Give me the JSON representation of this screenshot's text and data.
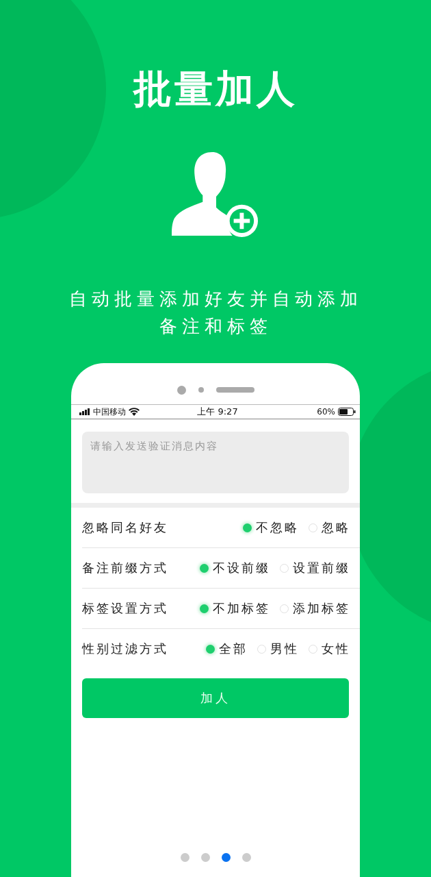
{
  "title": "批量加人",
  "subtitle_lines": [
    "自动批量添加好友并自动添加",
    "备注和标签"
  ],
  "phone": {
    "status_bar": {
      "carrier": "中国移动",
      "time": "上午 9:27",
      "battery": "60%"
    },
    "message_field": {
      "placeholder": "请输入发送验证消息内容"
    },
    "settings": [
      {
        "label": "忽略同名好友",
        "options": [
          {
            "label": "不忽略",
            "selected": true
          },
          {
            "label": "忽略",
            "selected": false
          }
        ]
      },
      {
        "label": "备注前缀方式",
        "options": [
          {
            "label": "不设前缀",
            "selected": true
          },
          {
            "label": "设置前缀",
            "selected": false
          }
        ]
      },
      {
        "label": "标签设置方式",
        "options": [
          {
            "label": "不加标签",
            "selected": true
          },
          {
            "label": "添加标签",
            "selected": false
          }
        ]
      },
      {
        "label": "性别过滤方式",
        "options": [
          {
            "label": "全部",
            "selected": true
          },
          {
            "label": "男性",
            "selected": false
          },
          {
            "label": "女性",
            "selected": false
          }
        ]
      }
    ],
    "submit_button": "加人"
  },
  "page_dots": [
    {
      "selected": false
    },
    {
      "selected": false
    },
    {
      "selected": true
    },
    {
      "selected": false
    }
  ]
}
